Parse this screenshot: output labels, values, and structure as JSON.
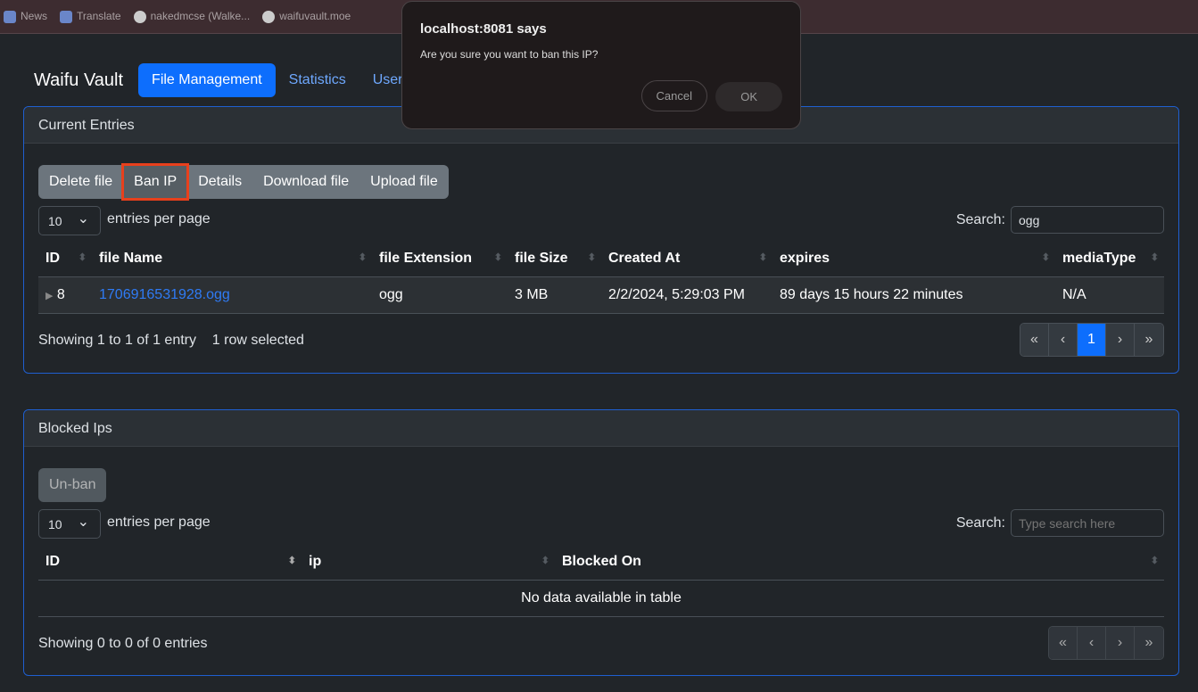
{
  "bookmarks": [
    "News",
    "Translate",
    "nakedmcse (Walke...",
    "waifuvault.moe"
  ],
  "nav": {
    "brand": "Waifu Vault",
    "tabs": [
      "File Management",
      "Statistics",
      "Users"
    ]
  },
  "entries": {
    "title": "Current Entries",
    "buttons": [
      "Delete file",
      "Ban IP",
      "Details",
      "Download file",
      "Upload file"
    ],
    "page_size": "10",
    "epp": "entries per page",
    "search_label": "Search:",
    "search_value": "ogg",
    "columns": [
      "ID",
      "file Name",
      "file Extension",
      "file Size",
      "Created At",
      "expires",
      "mediaType"
    ],
    "rows": [
      {
        "id": "8",
        "name": "1706916531928.ogg",
        "ext": "ogg",
        "size": "3 MB",
        "created": "2/2/2024, 5:29:03 PM",
        "expires": "89 days 15 hours 22 minutes",
        "media": "N/A"
      }
    ],
    "info": "Showing 1 to 1 of 1 entry",
    "selected": "1 row selected",
    "pages": [
      "«",
      "‹",
      "1",
      "›",
      "»"
    ]
  },
  "blocked": {
    "title": "Blocked Ips",
    "unban": "Un-ban",
    "page_size": "10",
    "epp": "entries per page",
    "search_label": "Search:",
    "search_placeholder": "Type search here",
    "columns": [
      "ID",
      "ip",
      "Blocked On"
    ],
    "empty": "No data available in table",
    "info": "Showing 0 to 0 of 0 entries",
    "pages": [
      "«",
      "‹",
      "›",
      "»"
    ]
  },
  "dialog": {
    "title": "localhost:8081 says",
    "message": "Are you sure you want to ban this IP?",
    "cancel": "Cancel",
    "ok": "OK"
  }
}
